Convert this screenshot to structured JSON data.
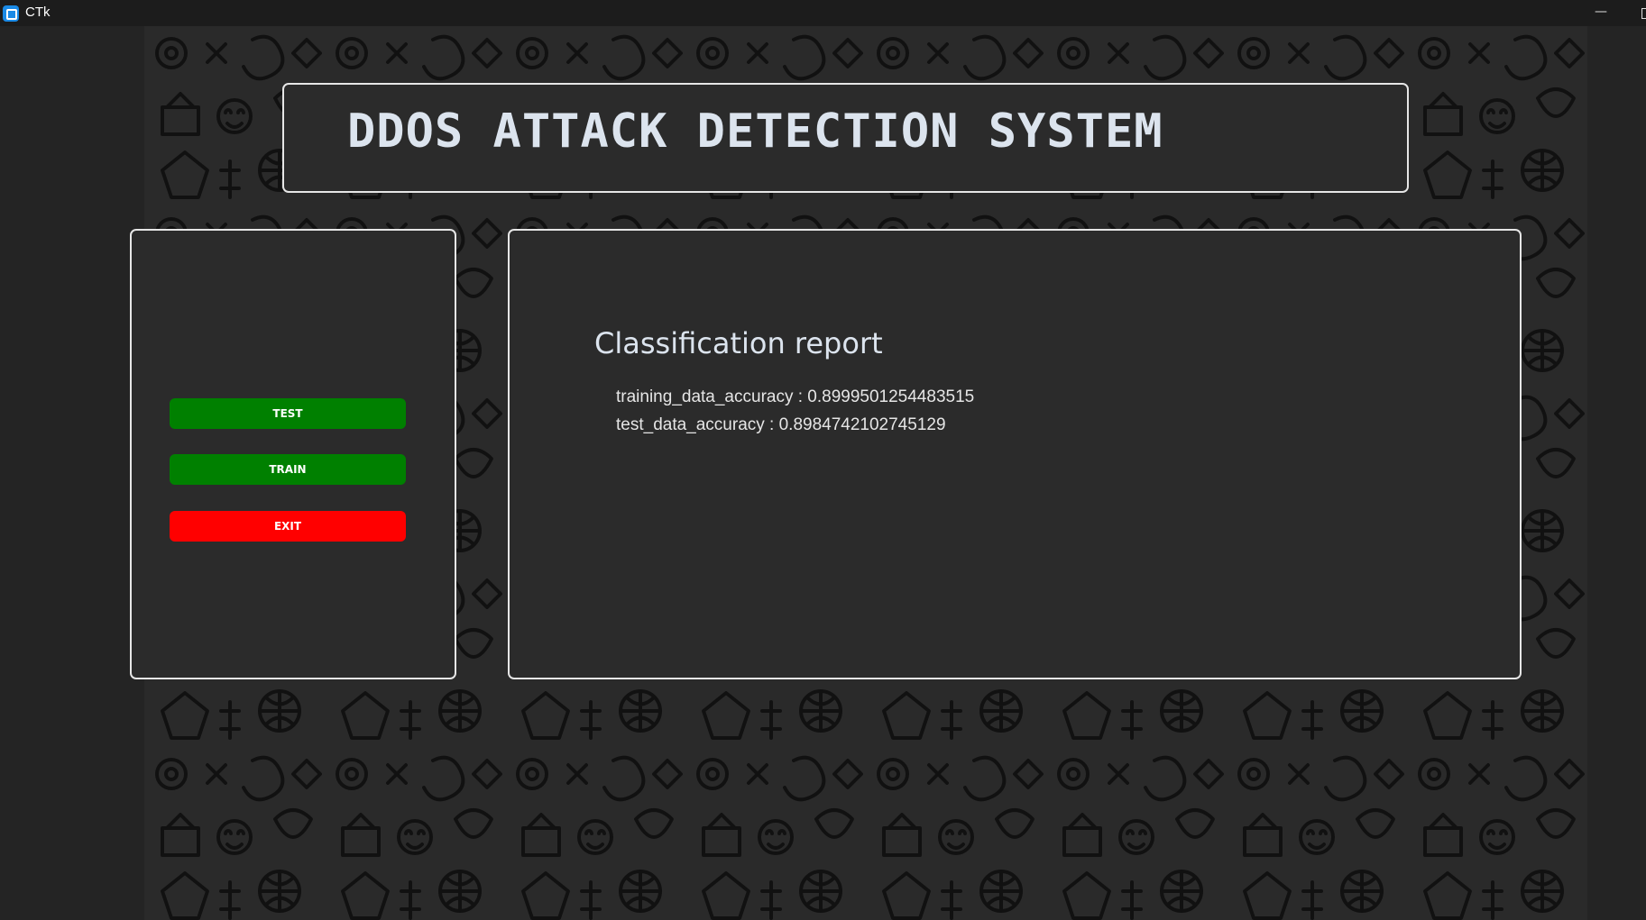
{
  "window": {
    "title": "CTk",
    "app_icon": "ctk-app-icon",
    "controls": [
      "minimize-icon",
      "maximize-icon"
    ]
  },
  "header": {
    "title": "DDOS ATTACK DETECTION SYSTEM"
  },
  "sidebar": {
    "buttons": [
      {
        "label": "TEST",
        "color": "#008000"
      },
      {
        "label": "TRAIN",
        "color": "#008000"
      },
      {
        "label": "EXIT",
        "color": "#ff0000"
      }
    ]
  },
  "report": {
    "title": "Classification report",
    "lines": [
      "training_data_accuracy : 0.8999501254483515",
      "test_data_accuracy : 0.8984742102745129"
    ]
  },
  "colors": {
    "window_bg": "#242424",
    "frame_bg": "#2b2b2b",
    "frame_border": "#e6e6e6",
    "title_text": "#dce4ee"
  }
}
